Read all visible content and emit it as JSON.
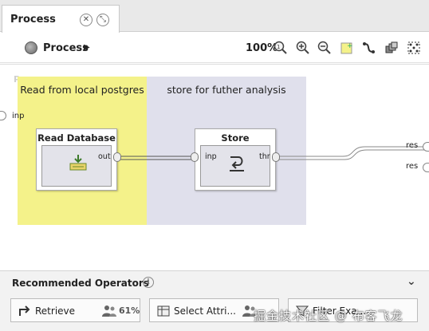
{
  "tab": {
    "title": "Process",
    "close_icon": "close-icon",
    "restore_icon": "restore-icon"
  },
  "toolbar": {
    "process_label": "Process",
    "zoom": "100%",
    "icons": [
      "zoom-fit-icon",
      "zoom-in-icon",
      "zoom-out-icon",
      "add-note-icon",
      "auto-wire-icon",
      "arrange-icon",
      "layout-icon"
    ]
  },
  "canvas": {
    "faint_label": "Process",
    "left_port": "inp",
    "right_ports": [
      "res",
      "res"
    ],
    "notes": [
      {
        "text": "Read from local postgres",
        "color": "#f4f28a"
      },
      {
        "text": "store for futher analysis",
        "color": "#e0e0ec"
      }
    ],
    "operators": [
      {
        "title": "Read Database",
        "ports_out": [
          "out"
        ],
        "icon": "database-read-icon"
      },
      {
        "title": "Store",
        "ports_in": [
          "inp"
        ],
        "ports_out": [
          "thr"
        ],
        "icon": "store-icon"
      }
    ]
  },
  "recommended": {
    "title": "Recommended Operators",
    "items": [
      {
        "label": "Retrieve",
        "percent": "61%",
        "icon": "retrieve-icon"
      },
      {
        "label": "Select Attri...",
        "icon": "select-attributes-icon"
      },
      {
        "label": "Filter Exa...",
        "icon": "filter-examples-icon"
      }
    ]
  },
  "watermark": "掘金技术社区 @ 布客飞龙",
  "colors": {
    "note_yellow": "#f4f28a",
    "note_purple": "#e0e0ec",
    "tabbar": "#e9e9e9"
  }
}
